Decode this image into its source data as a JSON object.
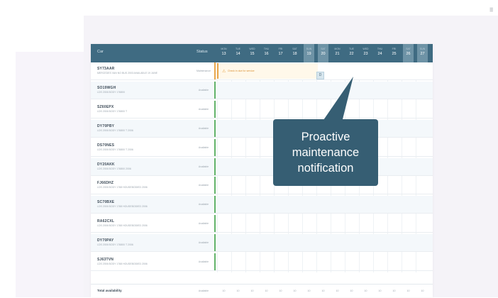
{
  "header": {
    "car_label": "Car",
    "status_label": "Status"
  },
  "days": [
    {
      "dow": "MON",
      "num": "13",
      "highlight": false
    },
    {
      "dow": "TUE",
      "num": "14",
      "highlight": false
    },
    {
      "dow": "WED",
      "num": "15",
      "highlight": false
    },
    {
      "dow": "THU",
      "num": "16",
      "highlight": false
    },
    {
      "dow": "FRI",
      "num": "17",
      "highlight": false
    },
    {
      "dow": "SAT",
      "num": "18",
      "highlight": false
    },
    {
      "dow": "SUN",
      "num": "19",
      "highlight": true
    },
    {
      "dow": "SAT",
      "num": "20",
      "highlight": true
    },
    {
      "dow": "MON",
      "num": "21",
      "highlight": false
    },
    {
      "dow": "TUE",
      "num": "22",
      "highlight": false
    },
    {
      "dow": "WED",
      "num": "23",
      "highlight": false
    },
    {
      "dow": "THU",
      "num": "24",
      "highlight": false
    },
    {
      "dow": "FRI",
      "num": "25",
      "highlight": false
    },
    {
      "dow": "SAT",
      "num": "26",
      "highlight": true
    },
    {
      "dow": "SUN",
      "num": "27",
      "highlight": true
    }
  ],
  "rows": [
    {
      "name": "SY73AAR",
      "sub": "MERCEDES VAN NO BUS 2003 AVAILABLE 19 JUNE",
      "status": "Maintenance"
    },
    {
      "name": "SO19WGH",
      "sub": "LDS 2006 BODY 176800",
      "status": "Available"
    },
    {
      "name": "SZ60EPX",
      "sub": "LDS 2006 BODY 176800 T",
      "status": "Available"
    },
    {
      "name": "DY70PBY",
      "sub": "LDS 2006 BODY 176800 T 2006",
      "status": "Available"
    },
    {
      "name": "DS70NES",
      "sub": "LDS 2006 BODY 176800 T 2006",
      "status": "Available"
    },
    {
      "name": "DY20AKK",
      "sub": "LDS 2006 BODY 176800 2006",
      "status": "Available"
    },
    {
      "name": "FJ66DHZ",
      "sub": "LDS 2006 BODY 1768 HOUSEBODIED 2006",
      "status": "Available"
    },
    {
      "name": "SC70BXE",
      "sub": "LDS 2006 BODY 1768 HOUSEBODIED 2006",
      "status": "Available"
    },
    {
      "name": "RA62CXL",
      "sub": "LDS 2006 BODY 1768 HOUSEBODIED 2006",
      "status": "Available"
    },
    {
      "name": "DY70PAY",
      "sub": "LDS 2006 BODY 176800 T 2006",
      "status": "Available"
    },
    {
      "name": "SJ63TVN",
      "sub": "LDS 2006 BODY 1768 HOUSEBODIED 2006",
      "status": "Available"
    }
  ],
  "event": {
    "label": "Check in due for service"
  },
  "event_marker": "D",
  "footer": {
    "label": "Total availability",
    "status": "Available",
    "values": [
      "10",
      "10",
      "10",
      "10",
      "10",
      "10",
      "10",
      "10",
      "10",
      "10",
      "10",
      "10",
      "10",
      "10",
      "10"
    ]
  },
  "callout": {
    "text": "Proactive\nmaintenance\nnotification"
  },
  "colors": {
    "header": "#3f6b82",
    "callout": "#365e73",
    "available": "#63b36a",
    "maintenance": "#e8a64b"
  }
}
